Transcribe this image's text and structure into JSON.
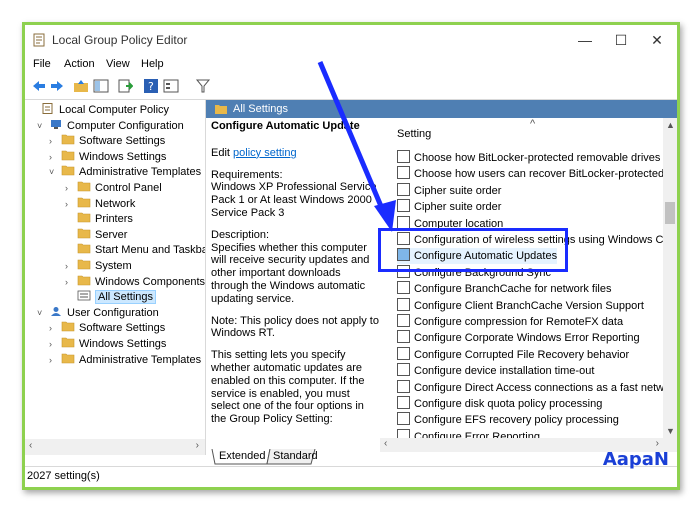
{
  "window": {
    "title": "Local Group Policy Editor",
    "minimize": "—",
    "maximize": "☐",
    "close": "✕"
  },
  "menu": [
    "File",
    "Action",
    "View",
    "Help"
  ],
  "tree": {
    "items": [
      {
        "label": "Local Computer Policy",
        "level": 0,
        "arrow": "",
        "icon": "policy-icon"
      },
      {
        "label": "Computer Configuration",
        "level": 1,
        "arrow": "˅",
        "icon": "computer-icon"
      },
      {
        "label": "Software Settings",
        "level": 2,
        "arrow": "›",
        "icon": "folder-icon"
      },
      {
        "label": "Windows Settings",
        "level": 2,
        "arrow": "›",
        "icon": "folder-icon"
      },
      {
        "label": "Administrative Templates",
        "level": 2,
        "arrow": "˅",
        "icon": "folder-icon"
      },
      {
        "label": "Control Panel",
        "level": 3,
        "arrow": "›",
        "icon": "folder-icon"
      },
      {
        "label": "Network",
        "level": 3,
        "arrow": "›",
        "icon": "folder-icon"
      },
      {
        "label": "Printers",
        "level": 3,
        "arrow": "",
        "icon": "folder-icon"
      },
      {
        "label": "Server",
        "level": 3,
        "arrow": "",
        "icon": "folder-icon"
      },
      {
        "label": "Start Menu and Taskba",
        "level": 3,
        "arrow": "",
        "icon": "folder-icon"
      },
      {
        "label": "System",
        "level": 3,
        "arrow": "›",
        "icon": "folder-icon"
      },
      {
        "label": "Windows Components",
        "level": 3,
        "arrow": "›",
        "icon": "folder-icon"
      },
      {
        "label": "All Settings",
        "level": 3,
        "arrow": "",
        "icon": "all-settings-icon",
        "selected": true
      },
      {
        "label": "User Configuration",
        "level": 1,
        "arrow": "˅",
        "icon": "user-icon"
      },
      {
        "label": "Software Settings",
        "level": 2,
        "arrow": "›",
        "icon": "folder-icon"
      },
      {
        "label": "Windows Settings",
        "level": 2,
        "arrow": "›",
        "icon": "folder-icon"
      },
      {
        "label": "Administrative Templates",
        "level": 2,
        "arrow": "›",
        "icon": "folder-icon"
      }
    ]
  },
  "detail": {
    "header": "All Settings",
    "title": "Configure Automatic Update",
    "edit_prefix": "Edit ",
    "edit_link": "policy setting",
    "req_label": "Requirements:",
    "req_text": "Windows XP Professional Service Pack 1 or At least Windows 2000 Service Pack 3",
    "desc_label": "Description:",
    "desc_text": "Specifies whether this computer will receive security updates and other important downloads through the Windows automatic updating service.",
    "note": "Note: This policy does not apply to Windows RT.",
    "more": "This setting lets you specify whether automatic updates are enabled on this computer. If the service is enabled, you must select one of the four options in the Group Policy Setting:"
  },
  "list": {
    "column": "Setting",
    "sort_indicator": "^",
    "rows": [
      "Choose how BitLocker-protected removable drives can",
      "Choose how users can recover BitLocker-protected driv",
      "Cipher suite order",
      "Cipher suite order",
      "Computer location",
      "Configuration of wireless settings using Windows Conn",
      "Configure Automatic Updates",
      "Configure Background Sync",
      "Configure BranchCache for network files",
      "Configure Client BranchCache Version Support",
      "Configure compression for RemoteFX data",
      "Configure Corporate Windows Error Reporting",
      "Configure Corrupted File Recovery behavior",
      "Configure device installation time-out",
      "Configure Direct Access connections as a fast network",
      "Configure disk quota policy processing",
      "Configure EFS recovery policy processing",
      "Configure Error Reporting"
    ],
    "highlight_index": 6
  },
  "tabs": [
    "Extended",
    "Standard"
  ],
  "status": "2027 setting(s)",
  "watermark": "AapaN",
  "colors": {
    "highlight_box": "#1a2cff",
    "arrow": "#1a2cff",
    "frame": "#8ed14f",
    "header": "#4f7fb3"
  }
}
